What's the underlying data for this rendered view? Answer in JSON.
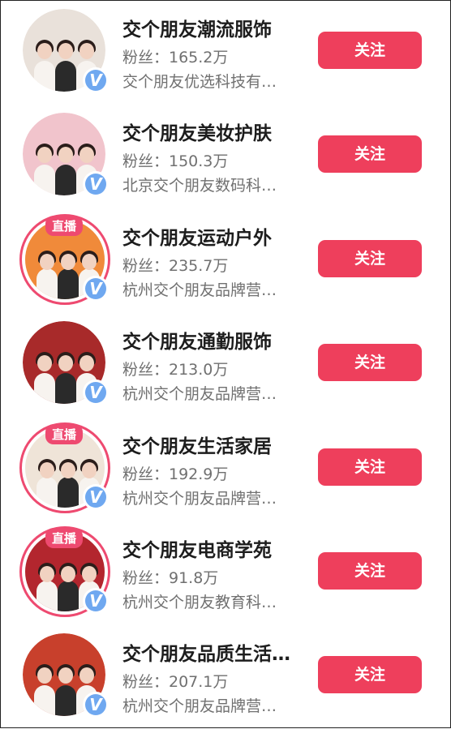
{
  "accounts": [
    {
      "name": "交个朋友潮流服饰",
      "fans": "粉丝：165.2万",
      "company": "交个朋友优选科技有…",
      "follow": "关注",
      "live": false,
      "live_label": "",
      "bg": "#e9e1da"
    },
    {
      "name": "交个朋友美妆护肤",
      "fans": "粉丝：150.3万",
      "company": "北京交个朋友数码科…",
      "follow": "关注",
      "live": false,
      "live_label": "",
      "bg": "#f1c4cc"
    },
    {
      "name": "交个朋友运动户外",
      "fans": "粉丝：235.7万",
      "company": "杭州交个朋友品牌营…",
      "follow": "关注",
      "live": true,
      "live_label": "直播",
      "bg": "#f08a3a"
    },
    {
      "name": "交个朋友通勤服饰",
      "fans": "粉丝：213.0万",
      "company": "杭州交个朋友品牌营…",
      "follow": "关注",
      "live": false,
      "live_label": "",
      "bg": "#a82a2a"
    },
    {
      "name": "交个朋友生活家居",
      "fans": "粉丝：192.9万",
      "company": "杭州交个朋友品牌营…",
      "follow": "关注",
      "live": true,
      "live_label": "直播",
      "bg": "#efe4d8"
    },
    {
      "name": "交个朋友电商学苑",
      "fans": "粉丝：91.8万",
      "company": "杭州交个朋友教育科…",
      "follow": "关注",
      "live": true,
      "live_label": "直播",
      "bg": "#b3262e"
    },
    {
      "name": "交个朋友品质生活…",
      "fans": "粉丝：207.1万",
      "company": "杭州交个朋友品牌营…",
      "follow": "关注",
      "live": false,
      "live_label": "",
      "bg": "#c8402c"
    }
  ],
  "colors": {
    "accent": "#ee3f5c",
    "live_ring": "#ee4a70",
    "verified": "#6fa8f0"
  }
}
